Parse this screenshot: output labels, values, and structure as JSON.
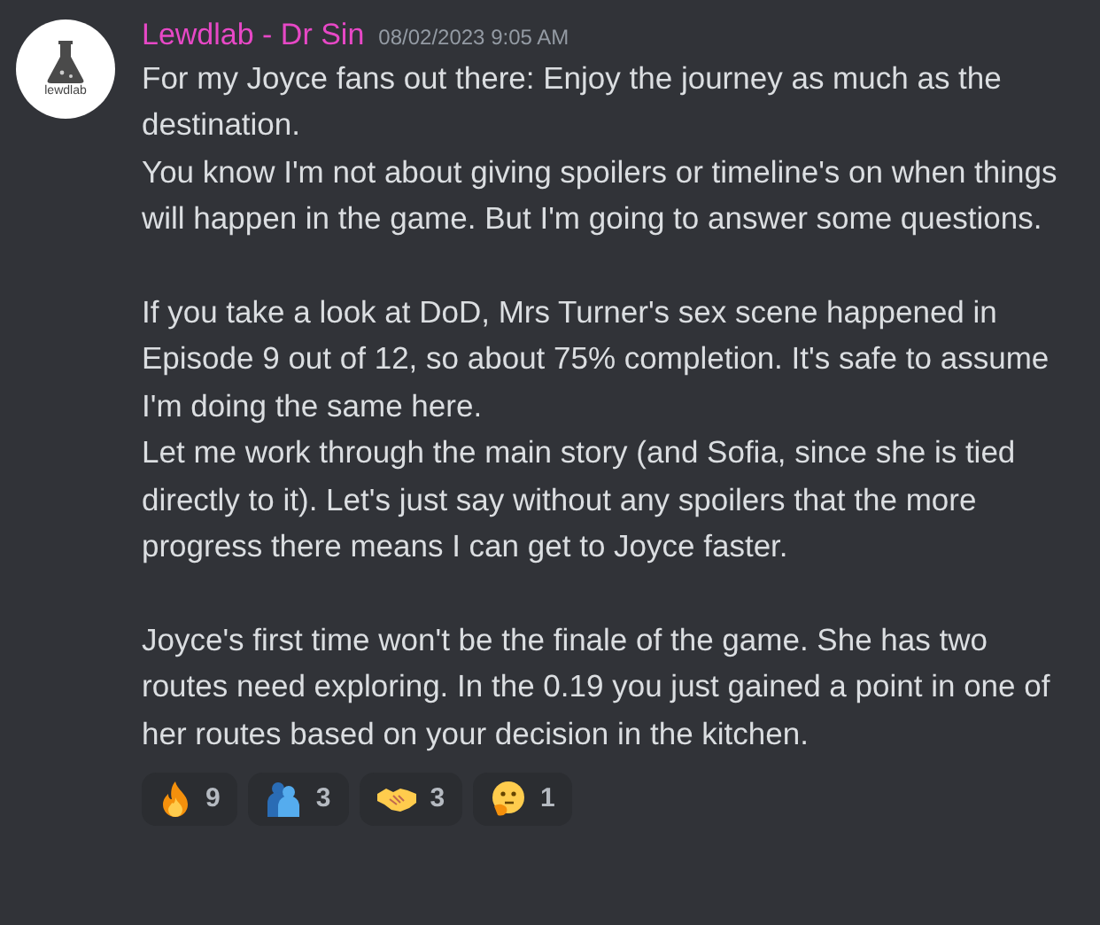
{
  "message": {
    "avatar_label": "lewdlab",
    "author": "Lewdlab - Dr Sin",
    "timestamp": "08/02/2023 9:05 AM",
    "blocks": [
      [
        "For my Joyce fans out there: Enjoy the journey as much as the destination.",
        "You know I'm not about giving spoilers or timeline's on when things will happen in the game. But I'm going to answer some questions."
      ],
      [
        "If you take a look at DoD, Mrs Turner's sex scene happened in Episode 9 out of 12, so about 75% completion. It's safe to assume I'm doing the same here.",
        "Let me work through the main story (and Sofia, since she is tied directly to it). Let's just say without any spoilers that the more progress there means I can get to Joyce faster."
      ],
      [
        "Joyce's first time won't be the finale of the game. She has two routes need exploring. In the 0.19 you just gained a point in one of her routes based on your decision in the kitchen."
      ]
    ],
    "reactions": [
      {
        "kind": "fire",
        "count": "9"
      },
      {
        "kind": "hug",
        "count": "3"
      },
      {
        "kind": "handshake",
        "count": "3"
      },
      {
        "kind": "thinking",
        "count": "1"
      }
    ]
  }
}
